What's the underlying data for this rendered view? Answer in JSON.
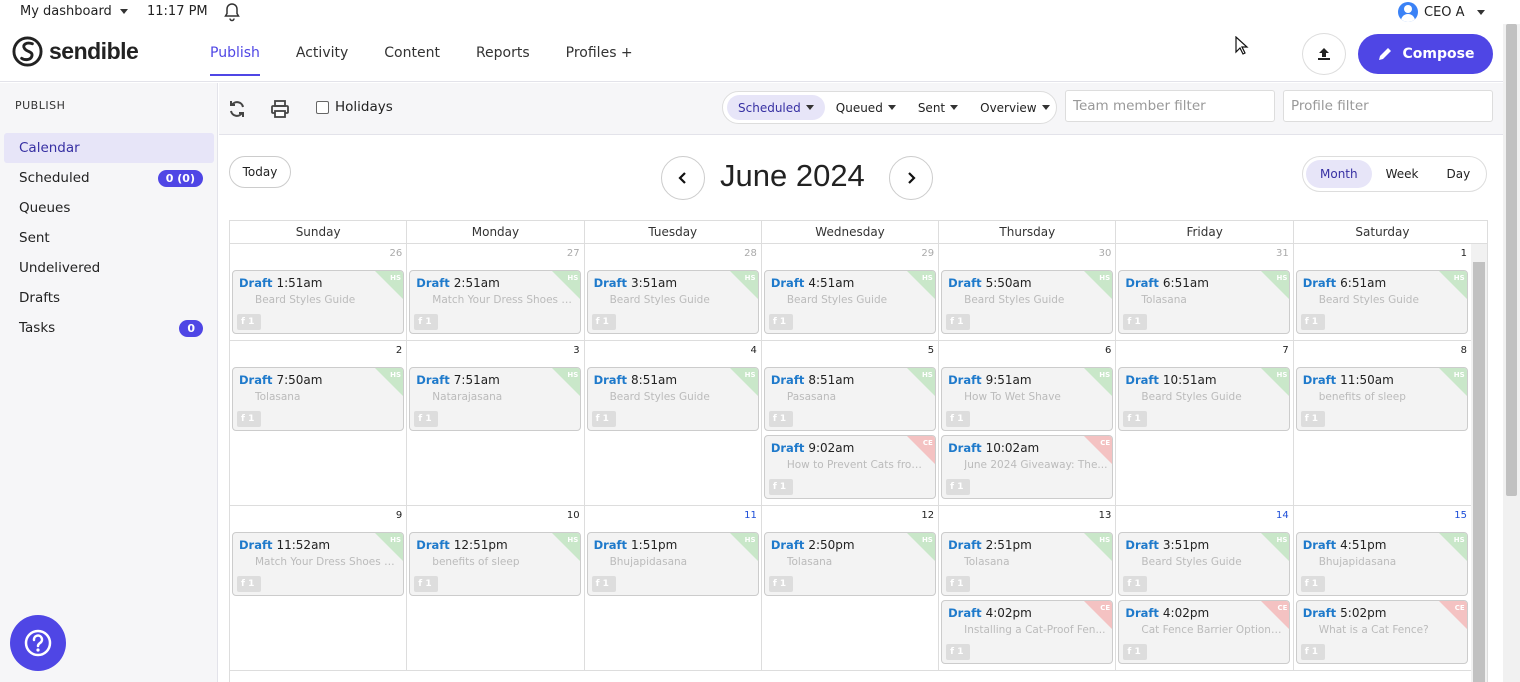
{
  "topbar": {
    "dashboard": "My dashboard",
    "time": "11:17 PM",
    "user": "CEO A"
  },
  "brand": {
    "name": "sendible",
    "accent": "#4f46e5"
  },
  "nav": [
    {
      "label": "Publish",
      "active": true
    },
    {
      "label": "Activity"
    },
    {
      "label": "Content"
    },
    {
      "label": "Reports"
    },
    {
      "label": "Profiles +"
    }
  ],
  "actions": {
    "compose": "Compose"
  },
  "sidebar": {
    "title": "PUBLISH",
    "items": [
      {
        "label": "Calendar",
        "active": true,
        "badge": ""
      },
      {
        "label": "Scheduled",
        "badge": "0 (0)"
      },
      {
        "label": "Queues",
        "badge": ""
      },
      {
        "label": "Sent",
        "badge": ""
      },
      {
        "label": "Undelivered",
        "badge": ""
      },
      {
        "label": "Drafts",
        "badge": ""
      },
      {
        "label": "Tasks",
        "badge": "0"
      }
    ]
  },
  "toolbar": {
    "holidays": "Holidays",
    "filters": [
      {
        "label": "Scheduled",
        "active": true
      },
      {
        "label": "Queued"
      },
      {
        "label": "Sent"
      },
      {
        "label": "Overview"
      }
    ],
    "team_placeholder": "Team member filter",
    "profile_placeholder": "Profile filter"
  },
  "calendar": {
    "today": "Today",
    "title": "June 2024",
    "views": [
      {
        "label": "Month",
        "active": true
      },
      {
        "label": "Week"
      },
      {
        "label": "Day"
      }
    ],
    "days_of_week": [
      "Sunday",
      "Monday",
      "Tuesday",
      "Wednesday",
      "Thursday",
      "Friday",
      "Saturday"
    ],
    "weeks": [
      {
        "days": [
          {
            "num": "26",
            "style": "muted",
            "events": [
              {
                "status": "Draft",
                "time": "1:51am",
                "title": "Beard Styles Guide",
                "tag": "HS"
              }
            ]
          },
          {
            "num": "27",
            "style": "muted",
            "events": [
              {
                "status": "Draft",
                "time": "2:51am",
                "title": "Match Your Dress Shoes A...",
                "tag": "HS"
              }
            ]
          },
          {
            "num": "28",
            "style": "muted",
            "events": [
              {
                "status": "Draft",
                "time": "3:51am",
                "title": "Beard Styles Guide",
                "tag": "HS"
              }
            ]
          },
          {
            "num": "29",
            "style": "muted",
            "events": [
              {
                "status": "Draft",
                "time": "4:51am",
                "title": "Beard Styles Guide",
                "tag": "HS"
              }
            ]
          },
          {
            "num": "30",
            "style": "muted",
            "events": [
              {
                "status": "Draft",
                "time": "5:50am",
                "title": "Beard Styles Guide",
                "tag": "HS"
              }
            ]
          },
          {
            "num": "31",
            "style": "muted",
            "events": [
              {
                "status": "Draft",
                "time": "6:51am",
                "title": "Tolasana",
                "tag": "HS"
              }
            ]
          },
          {
            "num": "1",
            "style": "",
            "events": [
              {
                "status": "Draft",
                "time": "6:51am",
                "title": "Beard Styles Guide",
                "tag": "HS"
              }
            ]
          }
        ]
      },
      {
        "days": [
          {
            "num": "2",
            "style": "",
            "events": [
              {
                "status": "Draft",
                "time": "7:50am",
                "title": "Tolasana",
                "tag": "HS"
              }
            ]
          },
          {
            "num": "3",
            "style": "",
            "events": [
              {
                "status": "Draft",
                "time": "7:51am",
                "title": "Natarajasana",
                "tag": "HS"
              }
            ]
          },
          {
            "num": "4",
            "style": "",
            "events": [
              {
                "status": "Draft",
                "time": "8:51am",
                "title": "Beard Styles Guide",
                "tag": "HS"
              }
            ]
          },
          {
            "num": "5",
            "style": "",
            "events": [
              {
                "status": "Draft",
                "time": "8:51am",
                "title": "Pasasana",
                "tag": "HS"
              },
              {
                "status": "Draft",
                "time": "9:02am",
                "title": "How to Prevent Cats from ...",
                "tag": "CE"
              }
            ]
          },
          {
            "num": "6",
            "style": "",
            "events": [
              {
                "status": "Draft",
                "time": "9:51am",
                "title": "How To Wet Shave",
                "tag": "HS"
              },
              {
                "status": "Draft",
                "time": "10:02am",
                "title": "June 2024 Giveaway: The...",
                "tag": "CE"
              }
            ]
          },
          {
            "num": "7",
            "style": "",
            "events": [
              {
                "status": "Draft",
                "time": "10:51am",
                "title": "Beard Styles Guide",
                "tag": "HS"
              }
            ]
          },
          {
            "num": "8",
            "style": "",
            "events": [
              {
                "status": "Draft",
                "time": "11:50am",
                "title": "benefits of sleep",
                "tag": "HS"
              }
            ]
          }
        ]
      },
      {
        "days": [
          {
            "num": "9",
            "style": "",
            "events": [
              {
                "status": "Draft",
                "time": "11:52am",
                "title": "Match Your Dress Shoes A...",
                "tag": "HS"
              }
            ]
          },
          {
            "num": "10",
            "style": "",
            "events": [
              {
                "status": "Draft",
                "time": "12:51pm",
                "title": "benefits of sleep",
                "tag": "HS"
              }
            ]
          },
          {
            "num": "11",
            "style": "blue",
            "events": [
              {
                "status": "Draft",
                "time": "1:51pm",
                "title": "Bhujapidasana",
                "tag": "HS"
              }
            ]
          },
          {
            "num": "12",
            "style": "",
            "events": [
              {
                "status": "Draft",
                "time": "2:50pm",
                "title": "Tolasana",
                "tag": "HS"
              }
            ]
          },
          {
            "num": "13",
            "style": "",
            "events": [
              {
                "status": "Draft",
                "time": "2:51pm",
                "title": "Tolasana",
                "tag": "HS"
              },
              {
                "status": "Draft",
                "time": "4:02pm",
                "title": "Installing a Cat-Proof Fen...",
                "tag": "CE"
              }
            ]
          },
          {
            "num": "14",
            "style": "blue",
            "events": [
              {
                "status": "Draft",
                "time": "3:51pm",
                "title": "Beard Styles Guide",
                "tag": "HS"
              },
              {
                "status": "Draft",
                "time": "4:02pm",
                "title": "Cat Fence Barrier Options ...",
                "tag": "CE"
              }
            ]
          },
          {
            "num": "15",
            "style": "blue",
            "events": [
              {
                "status": "Draft",
                "time": "4:51pm",
                "title": "Bhujapidasana",
                "tag": "HS"
              },
              {
                "status": "Draft",
                "time": "5:02pm",
                "title": "What is a Cat Fence?",
                "tag": "CE"
              }
            ]
          }
        ]
      }
    ],
    "network_icon": "facebook-icon",
    "network_count": "1"
  }
}
